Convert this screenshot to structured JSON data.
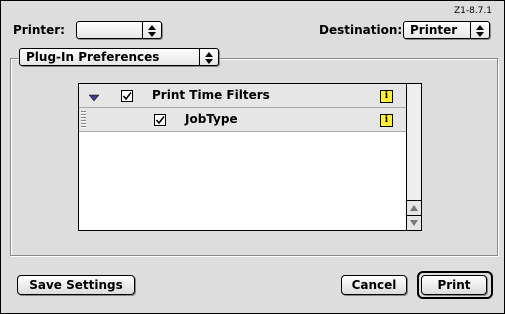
{
  "version": "Z1-8.7.1",
  "header": {
    "printer_label": "Printer:",
    "printer_value": "",
    "destination_label": "Destination:",
    "destination_value": "Printer"
  },
  "panel": {
    "selected": "Plug-In Preferences"
  },
  "list": {
    "rows": [
      {
        "label": "Print Time Filters",
        "checked": true,
        "expanded": true,
        "info_icon": "i"
      },
      {
        "label": "JobType",
        "checked": true,
        "info_icon": "i"
      }
    ]
  },
  "buttons": {
    "save": "Save Settings",
    "cancel": "Cancel",
    "print": "Print"
  },
  "colors": {
    "window_bg": "#dddddd",
    "info_icon": "#ffee33",
    "disclosure": "#3d3d8a"
  }
}
